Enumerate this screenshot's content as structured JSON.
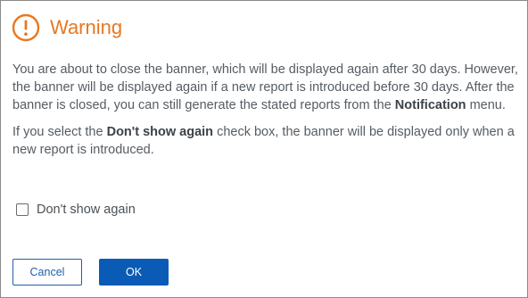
{
  "dialog": {
    "title": "Warning",
    "icon": "warning-circle-icon",
    "accent_color": "#e87722",
    "paragraph1": {
      "text_before": "You are about to close the banner, which will be displayed again after 30 days. However, the banner will be displayed again if a new report is introduced before 30 days. After the banner is closed, you can still generate the stated reports from the ",
      "bold": "Notification",
      "text_after": " menu."
    },
    "paragraph2": {
      "text_before": "If you select the ",
      "bold": "Don't show again",
      "text_after": " check box, the banner will be displayed only when a new report is introduced."
    },
    "checkbox": {
      "label": "Don't show again",
      "checked": false
    },
    "buttons": {
      "cancel": "Cancel",
      "ok": "OK"
    },
    "primary_color": "#0a5bb5"
  }
}
